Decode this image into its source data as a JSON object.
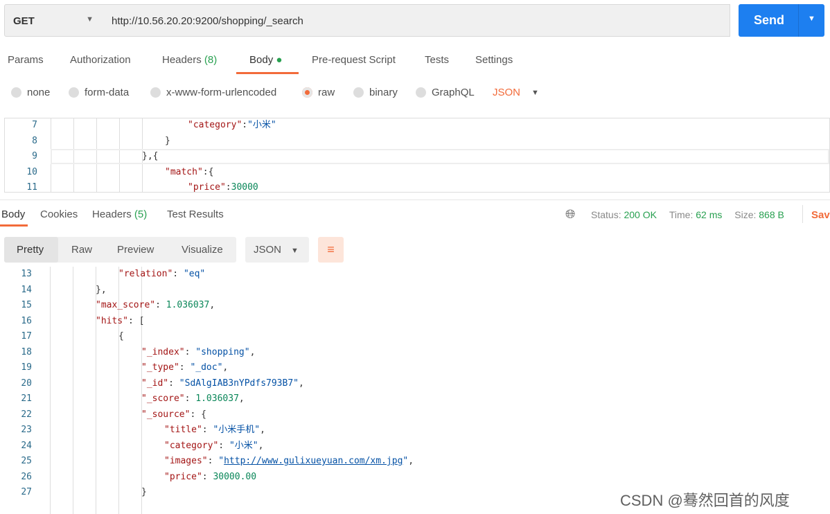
{
  "request": {
    "method": "GET",
    "url": "http://10.56.20.20:9200/shopping/_search",
    "send": "Send"
  },
  "req_tabs": [
    {
      "label": "Params"
    },
    {
      "label": "Authorization"
    },
    {
      "label": "Headers",
      "count": "(8)"
    },
    {
      "label": "Body"
    },
    {
      "label": "Pre-request Script"
    },
    {
      "label": "Tests"
    },
    {
      "label": "Settings"
    }
  ],
  "body_types": [
    "none",
    "form-data",
    "x-www-form-urlencoded",
    "raw",
    "binary",
    "GraphQL"
  ],
  "body_format": "JSON",
  "request_body": [
    {
      "n": "7",
      "i": 6,
      "t": [
        [
          "k",
          "\"category\""
        ],
        [
          "p",
          ":"
        ],
        [
          "s",
          "\"小米\""
        ]
      ]
    },
    {
      "n": "8",
      "i": 5,
      "t": [
        [
          "p",
          "}"
        ]
      ]
    },
    {
      "n": "9",
      "i": 4,
      "t": [
        [
          "p",
          "},{"
        ]
      ]
    },
    {
      "n": "10",
      "i": 5,
      "t": [
        [
          "k",
          "\"match\""
        ],
        [
          "p",
          ":{"
        ]
      ]
    },
    {
      "n": "11",
      "i": 6,
      "t": [
        [
          "k",
          "\"price\""
        ],
        [
          "p",
          ":"
        ],
        [
          "n",
          "30000"
        ]
      ]
    }
  ],
  "resp_tabs": [
    {
      "label": "Body"
    },
    {
      "label": "Cookies"
    },
    {
      "label": "Headers",
      "count": "(5)"
    },
    {
      "label": "Test Results"
    }
  ],
  "status": {
    "status_label": "Status:",
    "status": "200 OK",
    "time_label": "Time:",
    "time": "62 ms",
    "size_label": "Size:",
    "size": "868 B",
    "save": "Save"
  },
  "views": [
    "Pretty",
    "Raw",
    "Preview",
    "Visualize"
  ],
  "resp_format": "JSON",
  "response_body": [
    {
      "n": "13",
      "i": 3,
      "t": [
        [
          "k",
          "\"relation\""
        ],
        [
          "p",
          ": "
        ],
        [
          "s",
          "\"eq\""
        ]
      ]
    },
    {
      "n": "14",
      "i": 2,
      "t": [
        [
          "p",
          "},"
        ]
      ]
    },
    {
      "n": "15",
      "i": 2,
      "t": [
        [
          "k",
          "\"max_score\""
        ],
        [
          "p",
          ": "
        ],
        [
          "n",
          "1.036037"
        ],
        [
          "p",
          ","
        ]
      ]
    },
    {
      "n": "16",
      "i": 2,
      "t": [
        [
          "k",
          "\"hits\""
        ],
        [
          "p",
          ": ["
        ]
      ]
    },
    {
      "n": "17",
      "i": 3,
      "t": [
        [
          "p",
          "{"
        ]
      ]
    },
    {
      "n": "18",
      "i": 4,
      "t": [
        [
          "k",
          "\"_index\""
        ],
        [
          "p",
          ": "
        ],
        [
          "s",
          "\"shopping\""
        ],
        [
          "p",
          ","
        ]
      ]
    },
    {
      "n": "19",
      "i": 4,
      "t": [
        [
          "k",
          "\"_type\""
        ],
        [
          "p",
          ": "
        ],
        [
          "s",
          "\"_doc\""
        ],
        [
          "p",
          ","
        ]
      ]
    },
    {
      "n": "20",
      "i": 4,
      "t": [
        [
          "k",
          "\"_id\""
        ],
        [
          "p",
          ": "
        ],
        [
          "s",
          "\"SdAlgIAB3nYPdfs793B7\""
        ],
        [
          "p",
          ","
        ]
      ]
    },
    {
      "n": "21",
      "i": 4,
      "t": [
        [
          "k",
          "\"_score\""
        ],
        [
          "p",
          ": "
        ],
        [
          "n",
          "1.036037"
        ],
        [
          "p",
          ","
        ]
      ]
    },
    {
      "n": "22",
      "i": 4,
      "t": [
        [
          "k",
          "\"_source\""
        ],
        [
          "p",
          ": {"
        ]
      ]
    },
    {
      "n": "23",
      "i": 5,
      "t": [
        [
          "k",
          "\"title\""
        ],
        [
          "p",
          ": "
        ],
        [
          "s",
          "\"小米手机\""
        ],
        [
          "p",
          ","
        ]
      ]
    },
    {
      "n": "24",
      "i": 5,
      "t": [
        [
          "k",
          "\"category\""
        ],
        [
          "p",
          ": "
        ],
        [
          "s",
          "\"小米\""
        ],
        [
          "p",
          ","
        ]
      ]
    },
    {
      "n": "25",
      "i": 5,
      "t": [
        [
          "k",
          "\"images\""
        ],
        [
          "p",
          ": "
        ],
        [
          "s",
          "\""
        ],
        [
          "u",
          "http://www.gulixueyuan.com/xm.jpg"
        ],
        [
          "s",
          "\""
        ],
        [
          "p",
          ","
        ]
      ]
    },
    {
      "n": "26",
      "i": 5,
      "t": [
        [
          "k",
          "\"price\""
        ],
        [
          "p",
          ": "
        ],
        [
          "n",
          "30000.00"
        ]
      ]
    },
    {
      "n": "27",
      "i": 4,
      "t": [
        [
          "p",
          "}"
        ]
      ]
    }
  ],
  "watermark": "CSDN @蓦然回首的风度"
}
